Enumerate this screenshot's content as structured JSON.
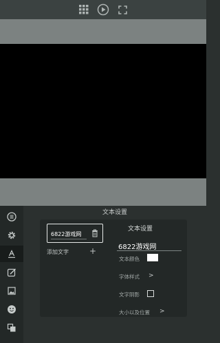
{
  "panel": {
    "title": "文本设置",
    "sidebar_items": [
      "list-icon",
      "gear-icon",
      "text-icon",
      "pen-icon",
      "image-icon",
      "smiley-icon",
      "layers-icon"
    ],
    "active_item": "text-icon"
  },
  "text_list": {
    "items": [
      {
        "label": "6822游戏网"
      }
    ],
    "add_label": "添加文字",
    "add_symbol": "+"
  },
  "text_settings": {
    "title": "文本设置",
    "text_value": "6822游戏网",
    "color_label": "文本颜色",
    "color_value": "#ffffff",
    "font_style_label": "字体样式",
    "shadow_label": "文字阴影",
    "size_position_label": "大小以及位置",
    "chevron": ">"
  },
  "colors": {
    "panel_bg": "#2b302f",
    "preview_bg": "#000000",
    "band": "#7c8281"
  }
}
